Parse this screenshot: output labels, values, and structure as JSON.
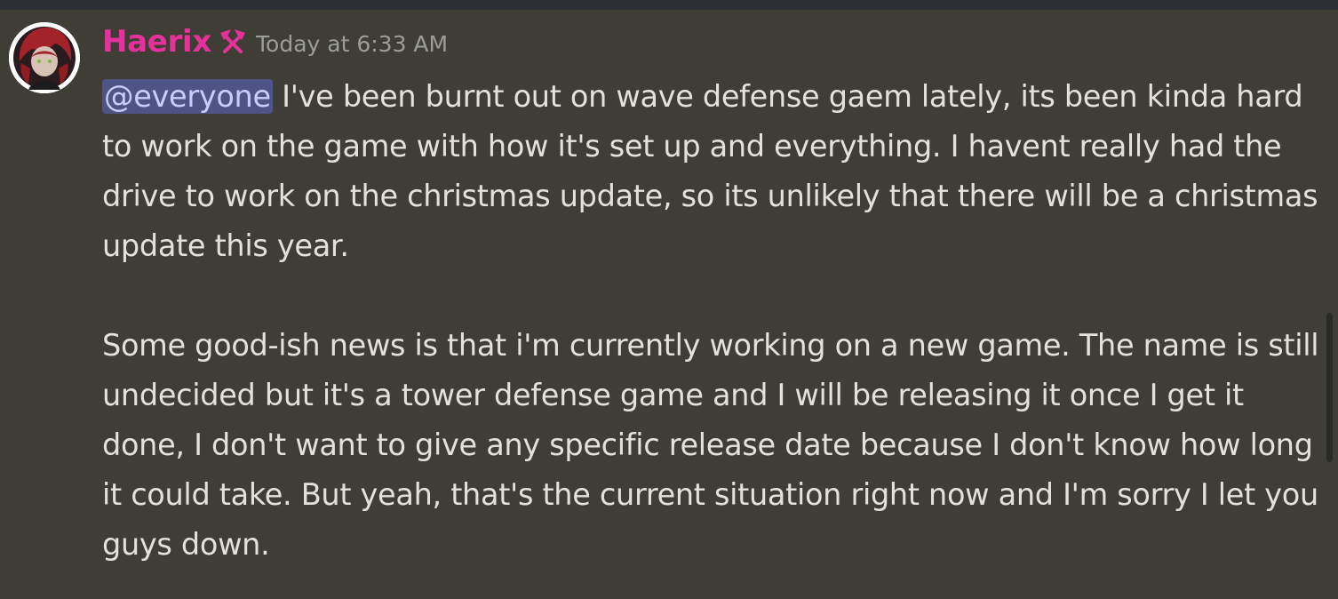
{
  "message": {
    "author": "Haerix",
    "timestamp": "Today at 6:33 AM",
    "author_color": "#e5329a",
    "role_icon": "hammer-pick-icon",
    "avatar_icon": "red-haired-avatar",
    "mention": "@everyone",
    "paragraph_1_text": " I've been burnt out on wave defense gaem lately, its been kinda hard to work on the game with how it's set up and everything. I havent really had the drive to work on the christmas update, so its unlikely that there will be a christmas update this year.",
    "paragraph_2_text": "Some good-ish news is that i'm currently working on a new game. The name is still undecided but it's a tower defense game and I will be releasing it once I get it done, I don't want to give any specific release date because I don't know how long it could take. But yeah, that's the current situation right now and I'm sorry I let you guys down."
  }
}
